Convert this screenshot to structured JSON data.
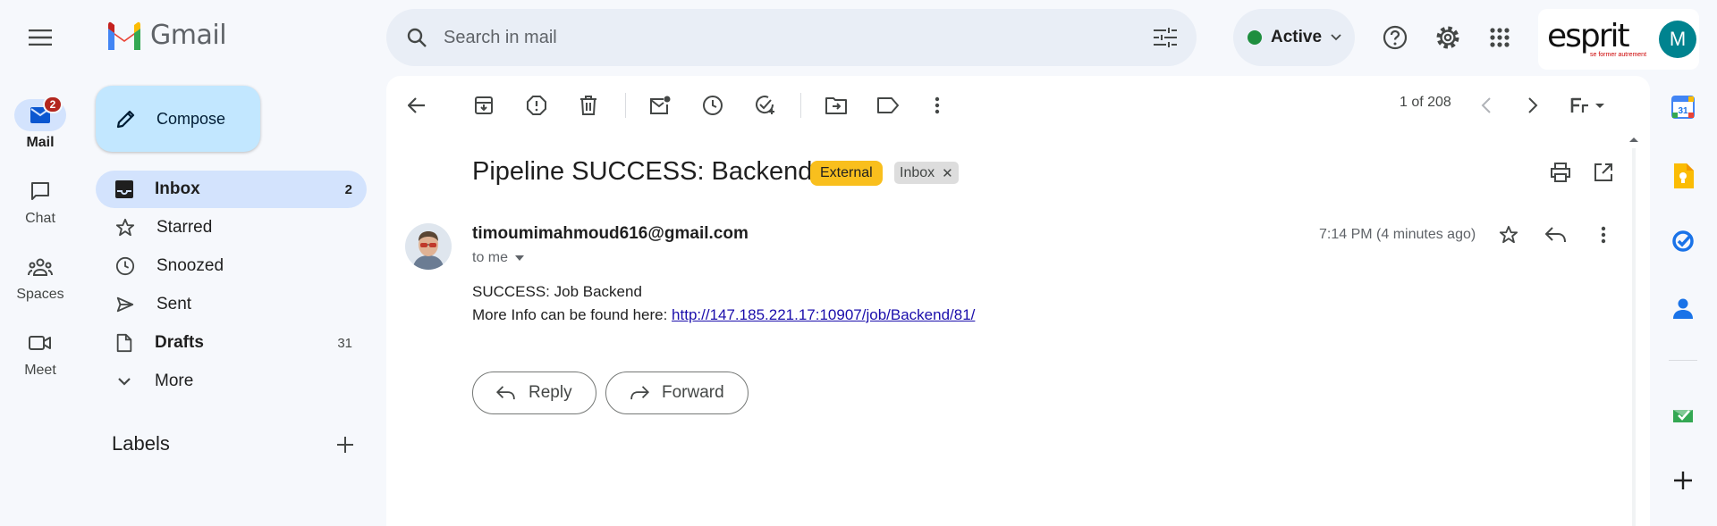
{
  "rail": {
    "items": [
      {
        "label": "Mail",
        "badge": "2"
      },
      {
        "label": "Chat"
      },
      {
        "label": "Spaces"
      },
      {
        "label": "Meet"
      }
    ]
  },
  "app": {
    "name": "Gmail"
  },
  "compose": {
    "label": "Compose"
  },
  "sidebar": {
    "items": [
      {
        "label": "Inbox",
        "count": "2"
      },
      {
        "label": "Starred",
        "count": ""
      },
      {
        "label": "Snoozed",
        "count": ""
      },
      {
        "label": "Sent",
        "count": ""
      },
      {
        "label": "Drafts",
        "count": "31"
      },
      {
        "label": "More",
        "count": ""
      }
    ],
    "labels_heading": "Labels"
  },
  "search": {
    "placeholder": "Search in mail",
    "value": ""
  },
  "status": {
    "label": "Active",
    "color": "#1e8e3e"
  },
  "account": {
    "org_name": "esprit",
    "org_tagline": "se former autrement",
    "avatar_letter": "M"
  },
  "toolbar": {
    "pager": "1 of 208"
  },
  "email": {
    "subject": "Pipeline SUCCESS: Backend",
    "chip_external": "External",
    "chip_inbox": "Inbox",
    "sender": "timoumimahmoud616@gmail.com",
    "recipient": "to me",
    "time": "7:14 PM (4 minutes ago)",
    "body_line1": "SUCCESS: Job Backend",
    "body_line2_prefix": "More Info can be found here: ",
    "body_link": "http://147.185.221.17:10907/job/Backend/81/"
  },
  "actions": {
    "reply": "Reply",
    "forward": "Forward"
  },
  "colors": {
    "accent": "#0b57d0",
    "active_nav": "#d3e3fd",
    "compose_bg": "#c2e7ff",
    "external_chip": "#f9bf1d"
  }
}
